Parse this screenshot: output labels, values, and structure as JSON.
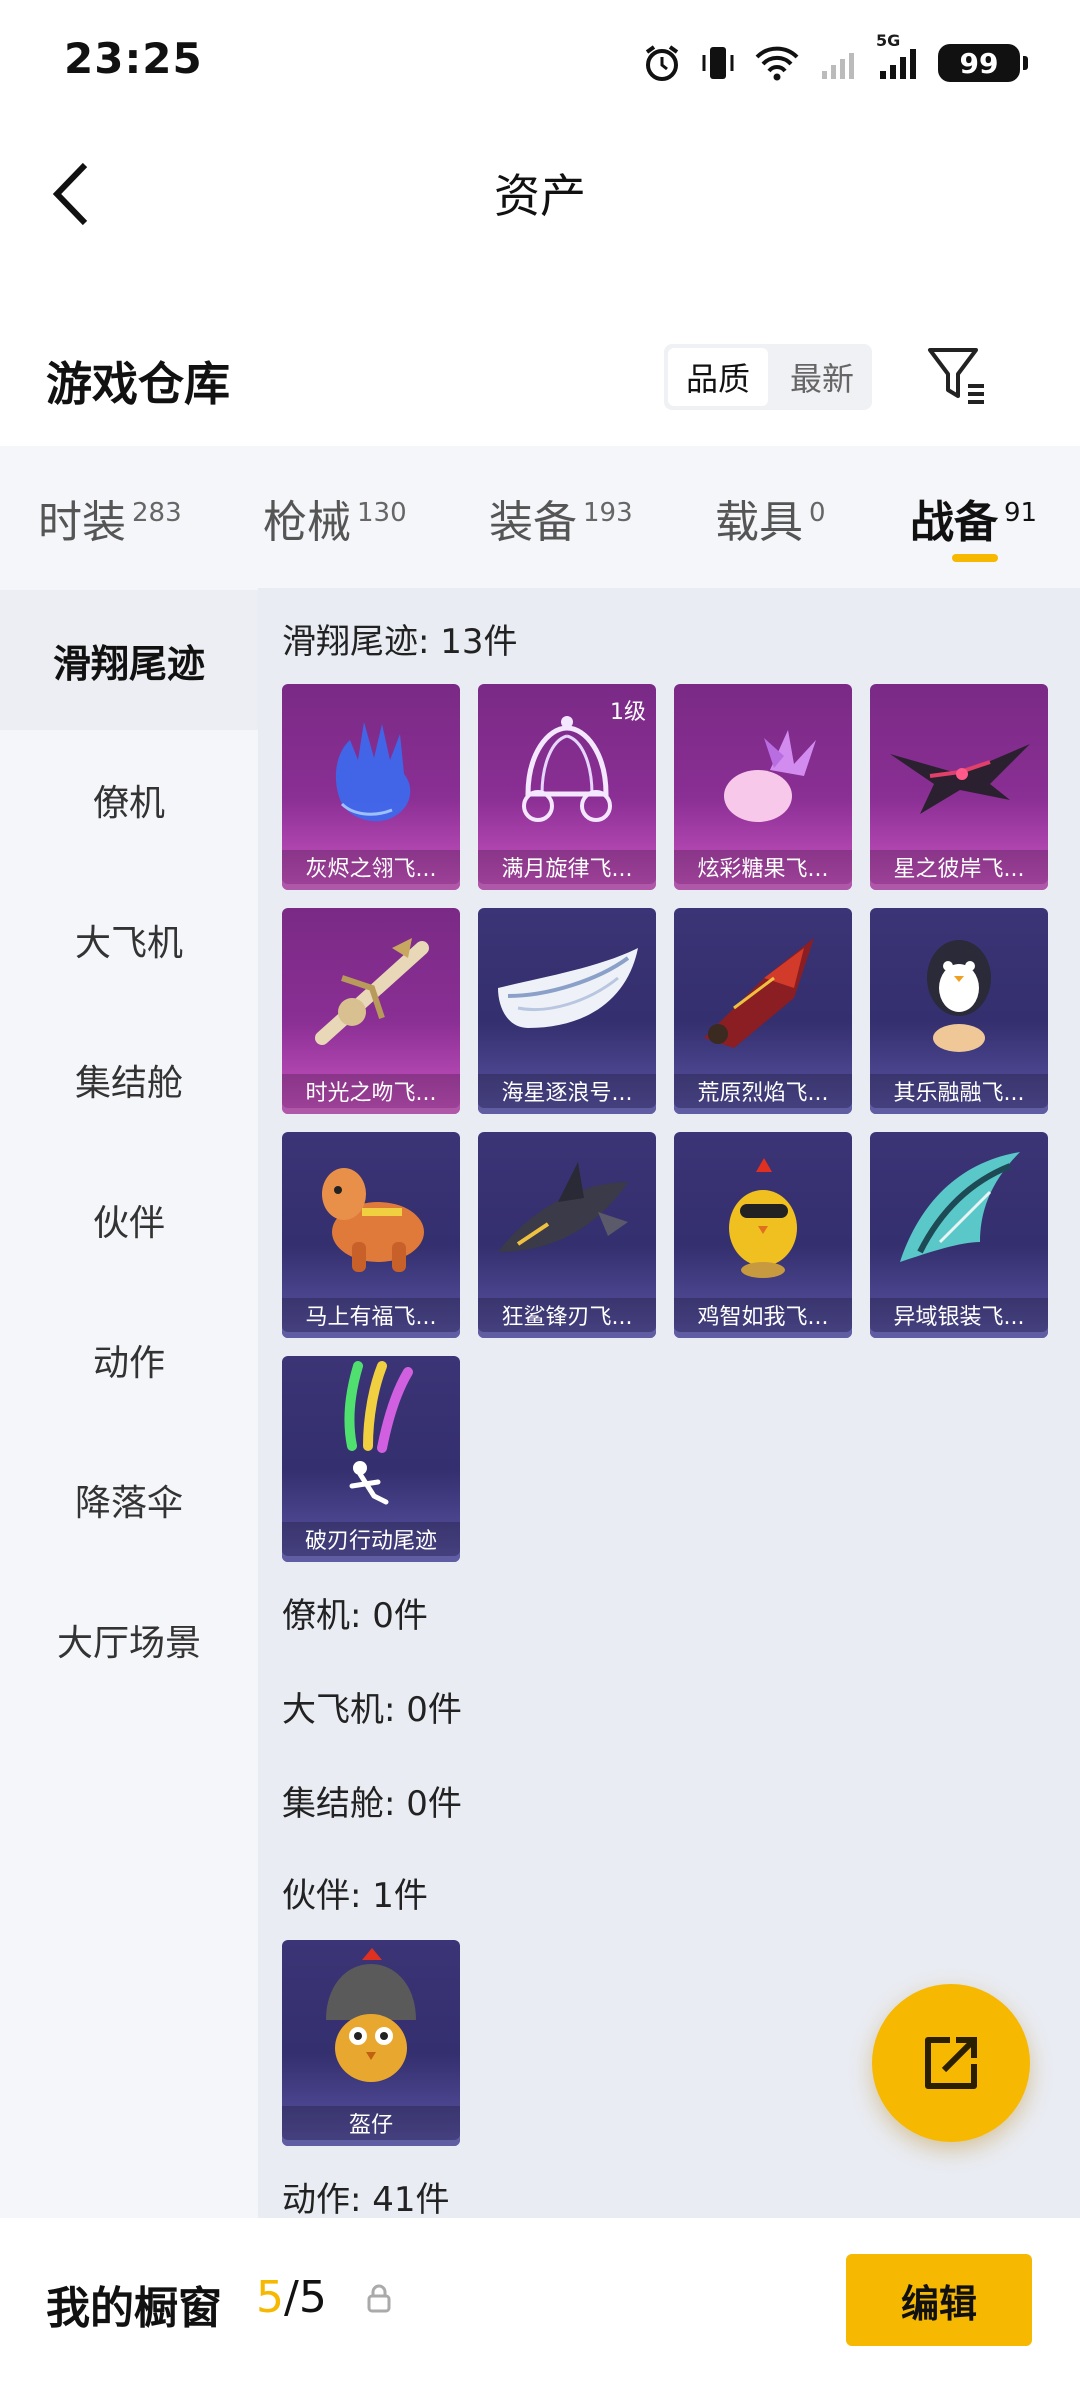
{
  "status_bar": {
    "time": "23:25",
    "battery": "99",
    "network": "5G"
  },
  "header": {
    "title": "资产"
  },
  "warehouse": {
    "title": "游戏仓库",
    "sort_options": [
      "品质",
      "最新"
    ],
    "sort_selected": "品质"
  },
  "tabs": [
    {
      "label": "时装",
      "count": "283"
    },
    {
      "label": "枪械",
      "count": "130"
    },
    {
      "label": "装备",
      "count": "193"
    },
    {
      "label": "载具",
      "count": "0"
    },
    {
      "label": "战备",
      "count": "91"
    }
  ],
  "active_tab": "战备",
  "sidebar": {
    "items": [
      "滑翔尾迹",
      "僚机",
      "大飞机",
      "集结舱",
      "伙伴",
      "动作",
      "降落伞",
      "大厅场景"
    ],
    "active": "滑翔尾迹"
  },
  "sections": {
    "glide_trail": {
      "label": "滑翔尾迹: 13件",
      "items": [
        {
          "name": "灰烬之翎飞...",
          "rarity": "purple",
          "icon": "blue-glove-icon"
        },
        {
          "name": "满月旋律飞...",
          "rarity": "purple",
          "icon": "carriage-icon",
          "level": "1级"
        },
        {
          "name": "炫彩糖果飞...",
          "rarity": "purple",
          "icon": "candy-icon"
        },
        {
          "name": "星之彼岸飞...",
          "rarity": "purple",
          "icon": "dark-wing-icon"
        },
        {
          "name": "时光之吻飞...",
          "rarity": "purple",
          "icon": "clockwork-icon"
        },
        {
          "name": "海星逐浪号...",
          "rarity": "blue",
          "icon": "boat-icon"
        },
        {
          "name": "荒原烈焰飞...",
          "rarity": "blue",
          "icon": "flame-craft-icon"
        },
        {
          "name": "其乐融融飞...",
          "rarity": "blue",
          "icon": "penguin-icon"
        },
        {
          "name": "马上有福飞...",
          "rarity": "blue",
          "icon": "horse-toy-icon"
        },
        {
          "name": "狂鲨锋刃飞...",
          "rarity": "blue",
          "icon": "shark-icon"
        },
        {
          "name": "鸡智如我飞...",
          "rarity": "blue",
          "icon": "chicken-icon"
        },
        {
          "name": "异域银装飞...",
          "rarity": "blue",
          "icon": "silver-wing-icon"
        },
        {
          "name": "破刃行动尾迹",
          "rarity": "blue",
          "icon": "smoke-trail-icon"
        }
      ]
    },
    "wingman": {
      "label": "僚机: 0件"
    },
    "big_plane": {
      "label": "大飞机: 0件"
    },
    "pod": {
      "label": "集结舱: 0件"
    },
    "partner": {
      "label": "伙伴: 1件",
      "items": [
        {
          "name": "盔仔",
          "rarity": "blue",
          "icon": "helmet-chick-icon"
        }
      ]
    },
    "action": {
      "label": "动作: 41件"
    }
  },
  "bottom_bar": {
    "window_label": "我的橱窗",
    "window_current": "5",
    "window_total": "/5",
    "edit_label": "编辑"
  },
  "colors": {
    "accent": "#f6b800",
    "rarity_purple": "#8a2f94",
    "rarity_blue": "#342f6e"
  }
}
